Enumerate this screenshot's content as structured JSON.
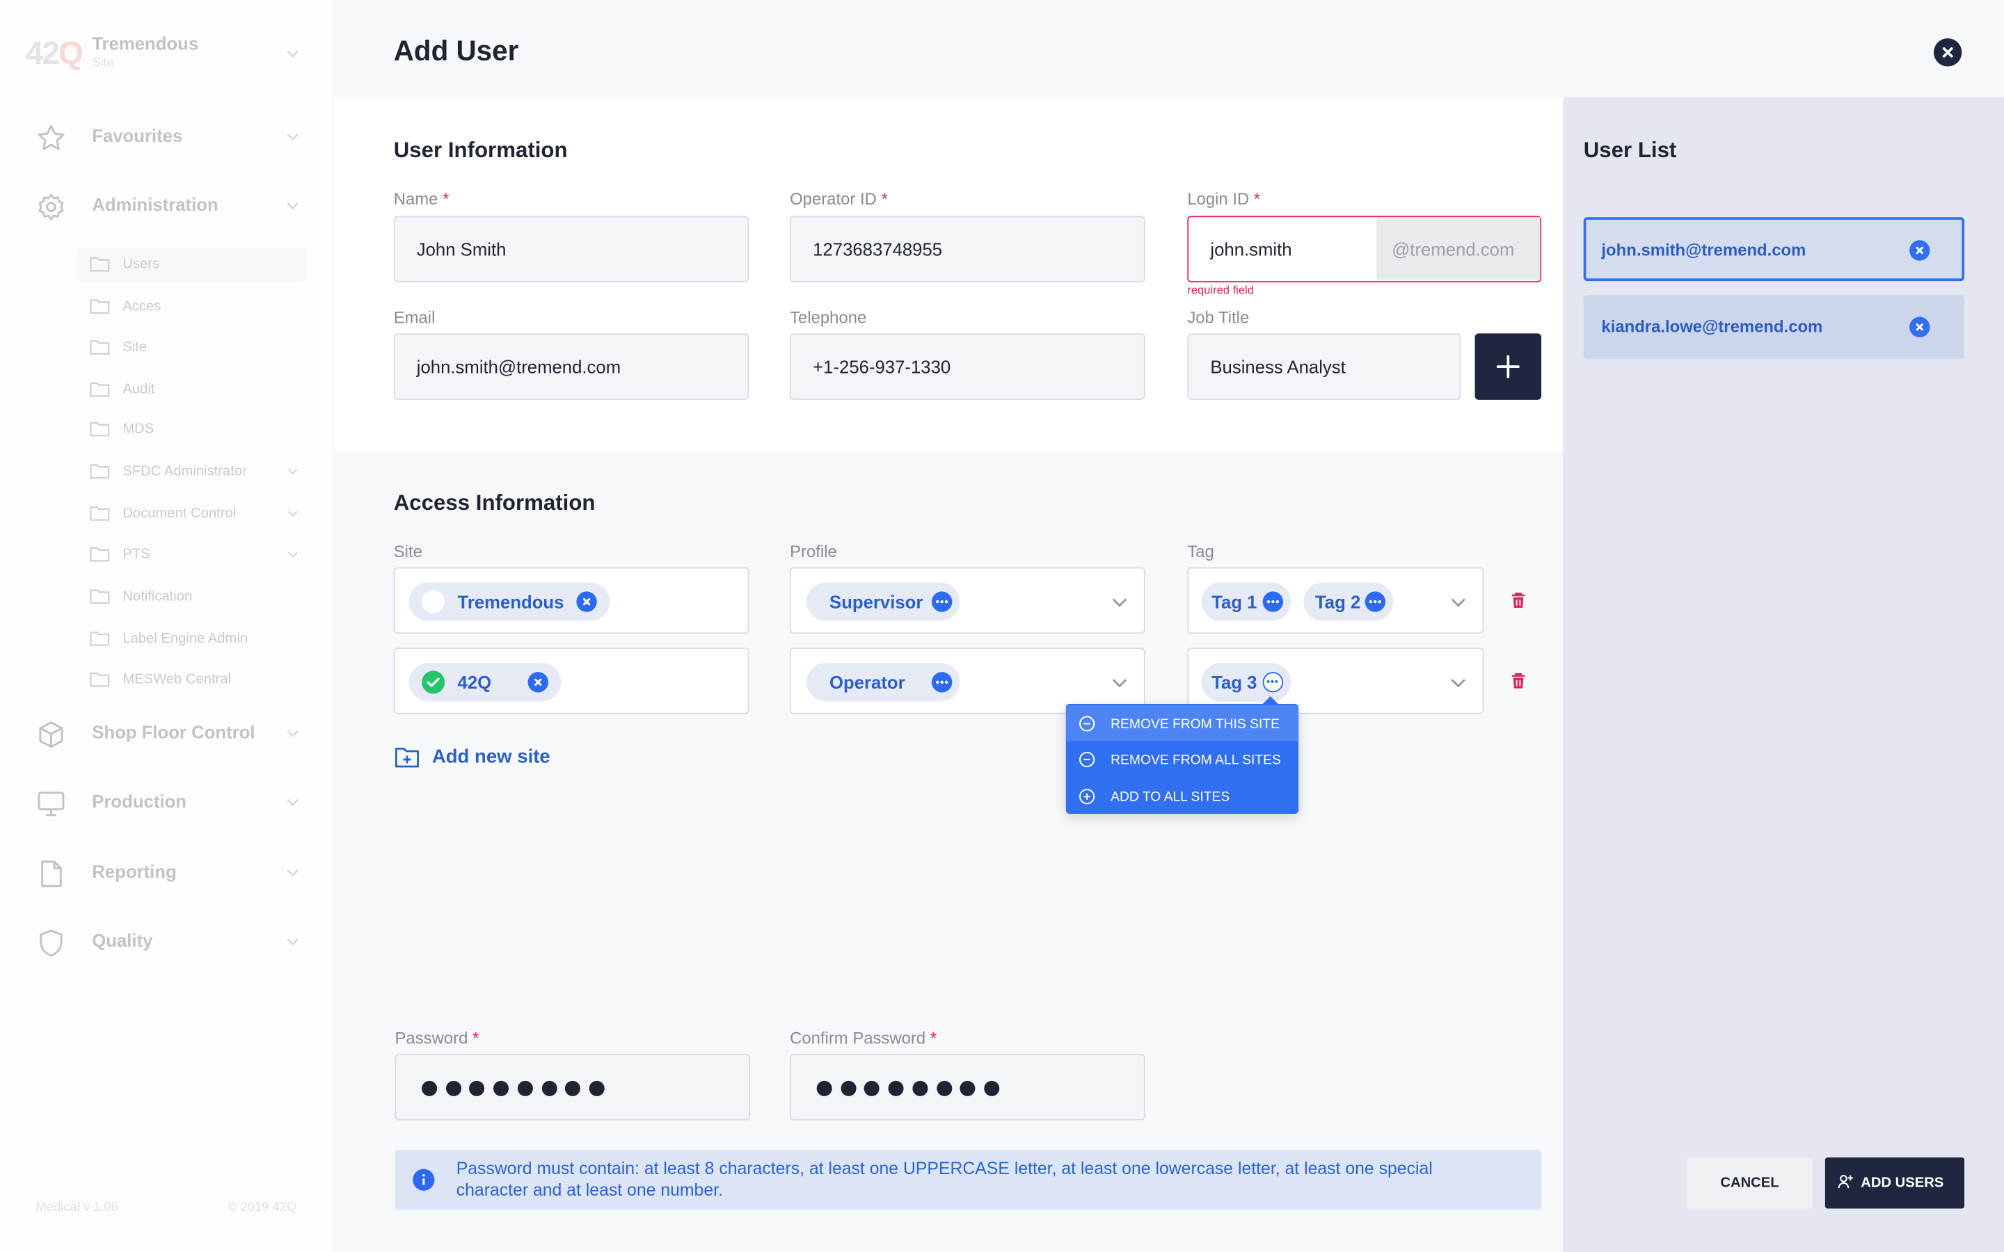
{
  "sidebar": {
    "logo": {
      "main": "42",
      "accent": "Q"
    },
    "org": {
      "name": "Tremendous",
      "sub": "Site"
    },
    "nav": [
      {
        "label": "Favourites",
        "icon": "star-icon"
      },
      {
        "label": "Administration",
        "icon": "gear-icon"
      },
      {
        "label": "Shop Floor Control",
        "icon": "cube-icon"
      },
      {
        "label": "Production",
        "icon": "monitor-icon"
      },
      {
        "label": "Reporting",
        "icon": "document-icon"
      },
      {
        "label": "Quality",
        "icon": "shield-icon"
      }
    ],
    "admin_items": [
      {
        "label": "Users"
      },
      {
        "label": "Acces"
      },
      {
        "label": "Site"
      },
      {
        "label": "Audit"
      },
      {
        "label": "MDS"
      },
      {
        "label": "SFDC Administrator"
      },
      {
        "label": "Document Control"
      },
      {
        "label": "PTS"
      },
      {
        "label": "Notification"
      },
      {
        "label": "Label Engine Admin"
      },
      {
        "label": "MESWeb Central"
      }
    ],
    "footer": {
      "version": "Medical v 1.06",
      "copyright": "© 2019 42Q"
    }
  },
  "header": {
    "title": "Add User"
  },
  "user_info": {
    "heading": "User Information",
    "name": {
      "label": "Name",
      "required": "*",
      "value": "John Smith"
    },
    "operator_id": {
      "label": "Operator ID",
      "required": "*",
      "value": "1273683748955"
    },
    "login_id": {
      "label": "Login ID",
      "required": "*",
      "value": "john.smith",
      "suffix": "@tremend.com",
      "error": "required field"
    },
    "email": {
      "label": "Email",
      "value": "john.smith@tremend.com"
    },
    "telephone": {
      "label": "Telephone",
      "value": "+1-256-937-1330"
    },
    "job_title": {
      "label": "Job Title",
      "value": "Business Analyst"
    }
  },
  "access": {
    "heading": "Access Information",
    "col_site": "Site",
    "col_profile": "Profile",
    "col_tag": "Tag",
    "rows": [
      {
        "site": "Tremendous",
        "site_checked": false,
        "profile": "Supervisor",
        "tags": [
          "Tag 1",
          "Tag 2"
        ]
      },
      {
        "site": "42Q",
        "site_checked": true,
        "profile": "Operator",
        "tags": [
          "Tag 3"
        ]
      }
    ],
    "add_site": "Add new site",
    "tag_menu": [
      {
        "label": "REMOVE FROM THIS SITE",
        "icon": "minus-circle-icon"
      },
      {
        "label": "REMOVE FROM ALL SITES",
        "icon": "minus-circle-icon"
      },
      {
        "label": "ADD TO ALL SITES",
        "icon": "plus-circle-icon"
      }
    ]
  },
  "password": {
    "label": "Password",
    "confirm_label": "Confirm Password",
    "required": "*",
    "masked_length": 8,
    "notice": "Password must contain:  at least 8 characters, at least one UPPERCASE letter, at least one lowercase letter, at least one special character  and at least one number."
  },
  "user_list": {
    "heading": "User List",
    "items": [
      "john.smith@tremend.com",
      "kiandra.lowe@tremend.com"
    ]
  },
  "actions": {
    "cancel": "CANCEL",
    "add_users": "ADD USERS"
  },
  "colors": {
    "primary": "#2f6ff0",
    "dark": "#1f2640",
    "error": "#e0245e",
    "success": "#25c46a"
  }
}
